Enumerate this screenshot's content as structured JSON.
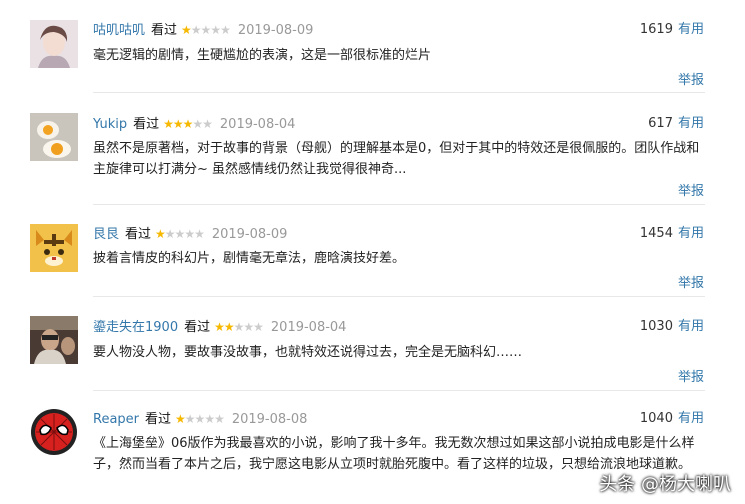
{
  "reviews": [
    {
      "user": "咕叽咕叽",
      "watched": "看过",
      "rating": 1,
      "date": "2019-08-09",
      "votes": "1619",
      "useful": "有用",
      "text": "毫无逻辑的剧情，生硬尴尬的表演，这是一部很标准的烂片",
      "report": "举报"
    },
    {
      "user": "Yukip",
      "watched": "看过",
      "rating": 3,
      "date": "2019-08-04",
      "votes": "617",
      "useful": "有用",
      "text": "虽然不是原著档，对于故事的背景（母舰）的理解基本是0，但对于其中的特效还是很佩服的。团队作战和主旋律可以打满分~ 虽然感情线仍然让我觉得很神奇...",
      "report": "举报"
    },
    {
      "user": "艮艮",
      "watched": "看过",
      "rating": 1,
      "date": "2019-08-09",
      "votes": "1454",
      "useful": "有用",
      "text": "披着言情皮的科幻片，剧情毫无章法，鹿晗演技好差。",
      "report": "举报"
    },
    {
      "user": "鎏走失在1900",
      "watched": "看过",
      "rating": 2,
      "date": "2019-08-04",
      "votes": "1030",
      "useful": "有用",
      "text": "要人物没人物，要故事没故事，也就特效还说得过去，完全是无脑科幻……",
      "report": "举报"
    },
    {
      "user": "Reaper",
      "watched": "看过",
      "rating": 1,
      "date": "2019-08-08",
      "votes": "1040",
      "useful": "有用",
      "text": "《上海堡垒》06版作为我最喜欢的小说，影响了我十多年。我无数次想过如果这部小说拍成电影是什么样子，然而当看了本片之后，我宁愿这电影从立项时就胎死腹中。看了这样的垃圾，只想给流浪地球道歉。",
      "report": ""
    }
  ],
  "watermark": "头条 @杨大喇叭"
}
